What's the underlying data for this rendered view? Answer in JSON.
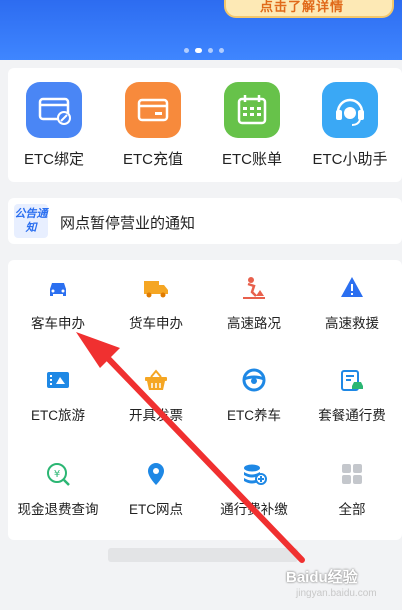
{
  "banner": {
    "promo_text": "点击了解详情"
  },
  "quick_actions": [
    {
      "label": "ETC绑定",
      "icon": "link-card-icon",
      "color": "#4a86f5"
    },
    {
      "label": "ETC充值",
      "icon": "recharge-card-icon",
      "color": "#f78a3c"
    },
    {
      "label": "ETC账单",
      "icon": "calendar-icon",
      "color": "#67c24a"
    },
    {
      "label": "ETC小助手",
      "icon": "headset-icon",
      "color": "#3aa8f5"
    }
  ],
  "notice": {
    "badge": "公告通知",
    "text": "网点暂停营业的通知"
  },
  "services": [
    {
      "label": "客车申办",
      "icon": "car-icon"
    },
    {
      "label": "货车申办",
      "icon": "truck-icon"
    },
    {
      "label": "高速路况",
      "icon": "road-work-icon"
    },
    {
      "label": "高速救援",
      "icon": "warning-icon"
    },
    {
      "label": "ETC旅游",
      "icon": "travel-icon"
    },
    {
      "label": "开具发票",
      "icon": "basket-icon"
    },
    {
      "label": "ETC养车",
      "icon": "steering-wheel-icon"
    },
    {
      "label": "套餐通行费",
      "icon": "package-icon"
    },
    {
      "label": "现金退费查询",
      "icon": "refund-icon"
    },
    {
      "label": "ETC网点",
      "icon": "location-pin-icon"
    },
    {
      "label": "通行费补缴",
      "icon": "coins-plus-icon"
    },
    {
      "label": "全部",
      "icon": "grid-all-icon"
    }
  ],
  "watermark": {
    "text": "Baidu经验",
    "sub": "jingyan.baidu.com"
  }
}
